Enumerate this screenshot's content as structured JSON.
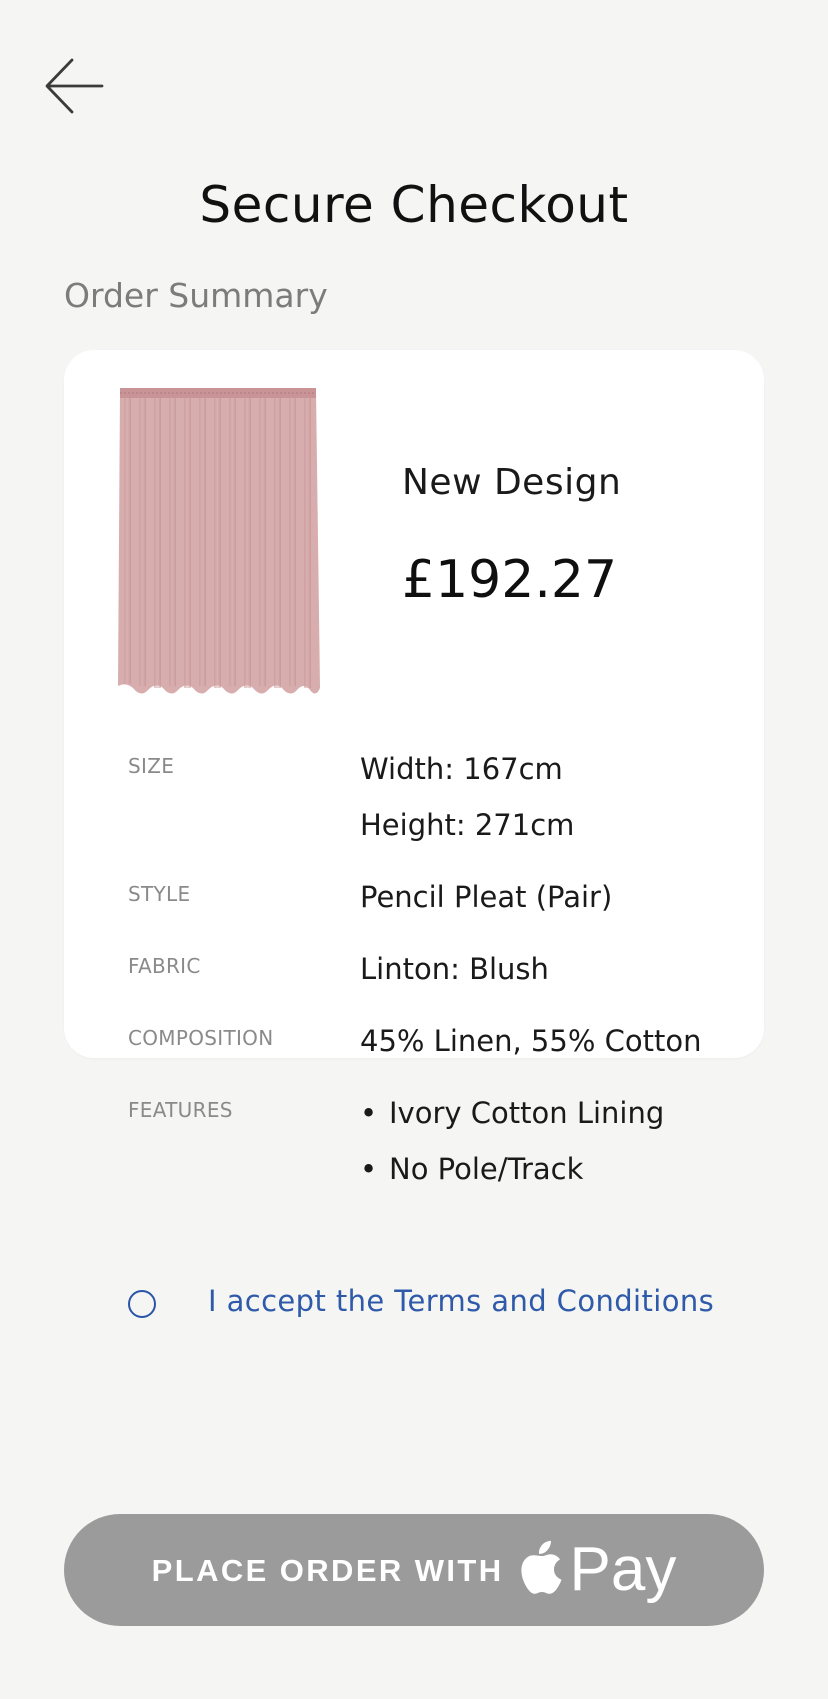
{
  "header": {
    "title": "Secure Checkout"
  },
  "order_summary": {
    "title": "Order Summary",
    "product": {
      "name": "New Design",
      "price": "£192.27",
      "image_icon": "curtain-image",
      "image_color": "#d7adae"
    },
    "specs": {
      "size": {
        "label": "SIZE",
        "width": "Width: 167cm",
        "height": "Height: 271cm"
      },
      "style": {
        "label": "STYLE",
        "value": "Pencil Pleat (Pair)"
      },
      "fabric": {
        "label": "FABRIC",
        "value": "Linton: Blush"
      },
      "composition": {
        "label": "COMPOSITION",
        "value": "45% Linen, 55% Cotton"
      },
      "features": {
        "label": "FEATURES",
        "bullet": "•",
        "items": [
          "Ivory Cotton Lining",
          "No Pole/Track"
        ]
      }
    },
    "terms": {
      "label": "I accept the Terms and Conditions",
      "checked": false,
      "color": "#2f5aa9"
    }
  },
  "checkout_button": {
    "label": "PLACE ORDER WITH",
    "pay_word": "Pay",
    "icon": "apple-icon",
    "background": "#9b9b9b"
  },
  "navigation": {
    "back_icon": "arrow-left-icon"
  }
}
